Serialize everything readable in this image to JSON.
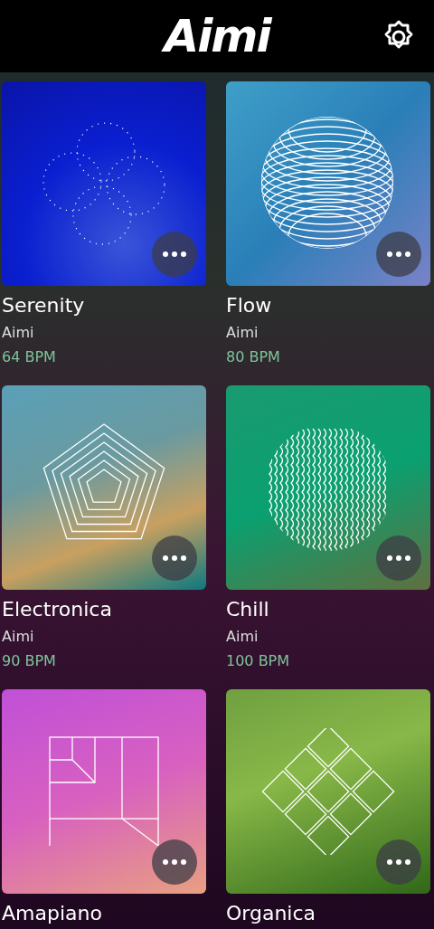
{
  "header": {
    "logo": "Aimi"
  },
  "experiences": [
    {
      "title": "Serenity",
      "artist": "Aimi",
      "bpm": "64 BPM",
      "kind": "dots"
    },
    {
      "title": "Flow",
      "artist": "Aimi",
      "bpm": "80 BPM",
      "kind": "sphere"
    },
    {
      "title": "Electronica",
      "artist": "Aimi",
      "bpm": "90 BPM",
      "kind": "pentagon"
    },
    {
      "title": "Chill",
      "artist": "Aimi",
      "bpm": "100 BPM",
      "kind": "waves"
    },
    {
      "title": "Amapiano",
      "kind": "squares"
    },
    {
      "title": "Organica",
      "kind": "diamonds"
    }
  ]
}
